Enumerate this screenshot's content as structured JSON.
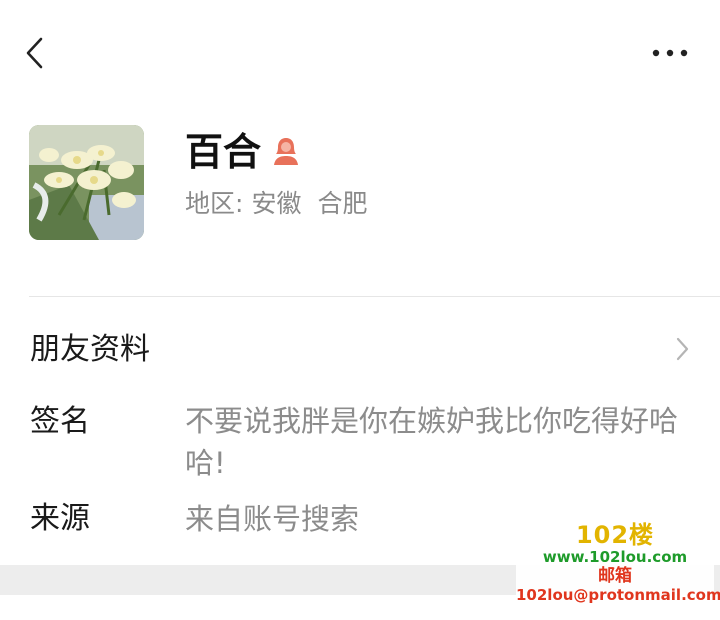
{
  "icons": {
    "back": "chevron-left-icon",
    "more": "more-dots-icon",
    "gender": "female-user-icon",
    "arrow": "chevron-right-icon"
  },
  "profile": {
    "name": "百合",
    "region_label": "地区:",
    "region_province": "安徽",
    "region_city": "合肥"
  },
  "rows": {
    "friend_info_label": "朋友资料",
    "signature_label": "签名",
    "signature_value": "不要说我胖是你在嫉妒我比你吃得好哈哈!",
    "source_label": "来源",
    "source_value": "来自账号搜索"
  },
  "watermark": {
    "logo": "102楼",
    "site": "www.102lou.com",
    "mail": "邮箱",
    "email": "102lou@protonmail.com"
  },
  "colors": {
    "gender_icon": "#e8715a",
    "secondary_text": "#8a8a8a",
    "watermark_green": "#1e9b2a",
    "watermark_red": "#e0361e",
    "watermark_yellow": "#e2b400"
  }
}
